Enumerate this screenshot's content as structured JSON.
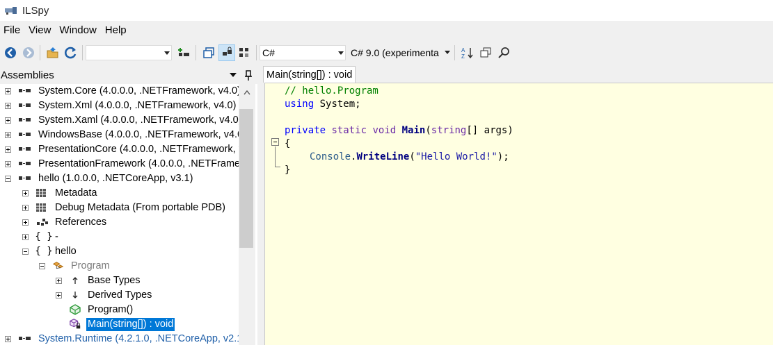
{
  "window": {
    "title": "ILSpy"
  },
  "menu": [
    "File",
    "View",
    "Window",
    "Help"
  ],
  "toolbar": {
    "search_combo_value": "",
    "language": "C#",
    "language_version": "C# 9.0 (experimenta"
  },
  "assemblies_panel": {
    "title": "Assemblies",
    "items": [
      {
        "label": "System.Core (4.0.0.0, .NETFramework, v4.0)",
        "icon": "assembly-icon"
      },
      {
        "label": "System.Xml (4.0.0.0, .NETFramework, v4.0)",
        "icon": "assembly-icon"
      },
      {
        "label": "System.Xaml (4.0.0.0, .NETFramework, v4.0)",
        "icon": "assembly-icon"
      },
      {
        "label": "WindowsBase (4.0.0.0, .NETFramework, v4.0)",
        "icon": "assembly-icon"
      },
      {
        "label": "PresentationCore (4.0.0.0, .NETFramework, v4",
        "icon": "assembly-icon"
      },
      {
        "label": "PresentationFramework (4.0.0.0, .NETFramew",
        "icon": "assembly-icon"
      },
      {
        "label": "hello (1.0.0.0, .NETCoreApp, v3.1)",
        "icon": "assembly-icon"
      },
      {
        "label": "Metadata",
        "icon": "metadata-icon"
      },
      {
        "label": "Debug Metadata (From portable PDB)",
        "icon": "metadata-icon"
      },
      {
        "label": "References",
        "icon": "references-icon"
      },
      {
        "label": "-",
        "icon": "namespace-icon"
      },
      {
        "label": "hello",
        "icon": "namespace-icon"
      },
      {
        "label": "Program",
        "icon": "class-icon"
      },
      {
        "label": "Base Types",
        "icon": "base-types-icon"
      },
      {
        "label": "Derived Types",
        "icon": "derived-types-icon"
      },
      {
        "label": "Program()",
        "icon": "constructor-icon"
      },
      {
        "label": "Main(string[]) : void",
        "icon": "static-method-icon"
      },
      {
        "label": "System.Runtime (4.2.1.0, .NETCoreApp, v2.1.2",
        "icon": "assembly-icon"
      }
    ]
  },
  "editor": {
    "tab_title": "Main(string[]) : void",
    "code": {
      "comment": "// hello.Program",
      "using_kw": "using",
      "using_ns": " System;",
      "mod_private": "private",
      "mod_static": " static",
      "ret_void": " void",
      "method_name": " Main",
      "paren_open": "(",
      "param_type": "string",
      "param_rest": "[] args)",
      "brace_open": "{",
      "call_class": "Console",
      "call_dot": ".",
      "call_method": "WriteLine",
      "call_open": "(",
      "call_string": "\"Hello World!\"",
      "call_close": ");",
      "brace_close": "}"
    }
  },
  "colors": {
    "selection": "#0078d7",
    "editor_background": "#ffffe1",
    "keyword": "#0000ff",
    "comment": "#008000"
  }
}
